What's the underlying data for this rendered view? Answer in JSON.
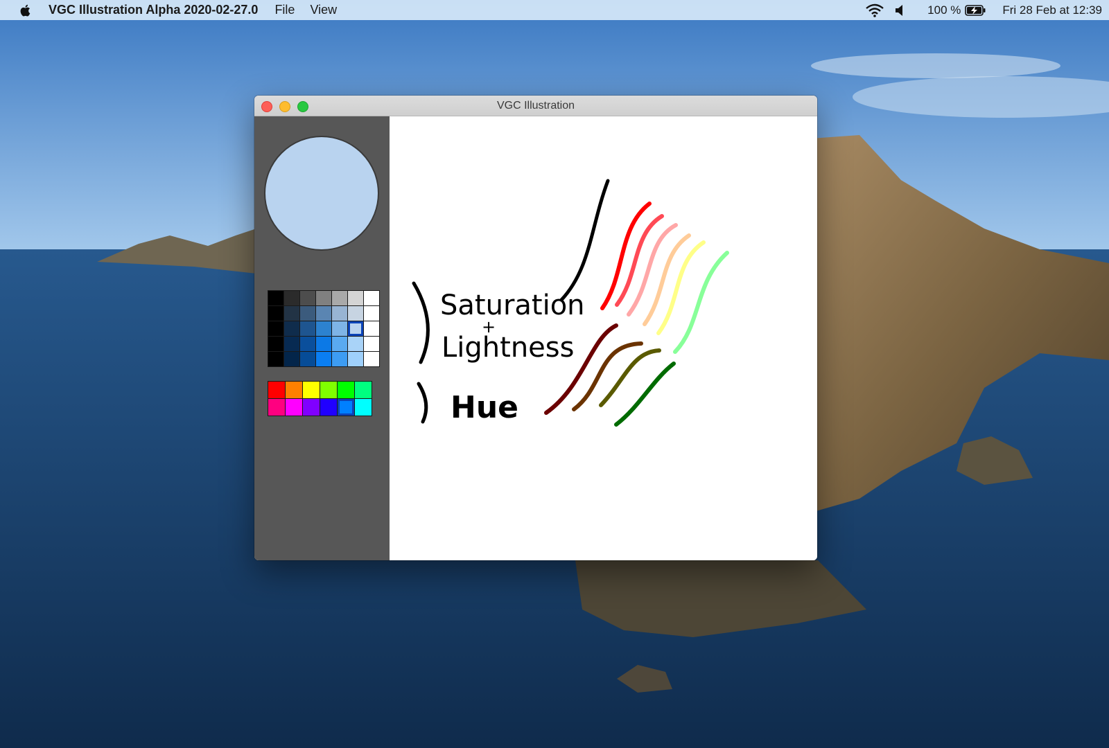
{
  "menubar": {
    "app_name": "VGC Illustration Alpha 2020-02-27.0",
    "menus": [
      "File",
      "View"
    ],
    "battery_percent": "100 %",
    "datetime": "Fri 28 Feb at  12:39"
  },
  "window": {
    "title": "VGC Illustration"
  },
  "palette": {
    "current_color": "#b9d3ef",
    "shade_grid": [
      [
        "#000000",
        "#2b2b2b",
        "#4d4d4d",
        "#808080",
        "#a9a9a9",
        "#d4d4d4",
        "#ffffff"
      ],
      [
        "#000000",
        "#223345",
        "#3b5b7d",
        "#5a85b2",
        "#98b4d3",
        "#c7d4e2",
        "#ffffff"
      ],
      [
        "#000000",
        "#0f2c4c",
        "#1e5590",
        "#2c82d0",
        "#7eb4e6",
        "#b9d3ef",
        "#ffffff"
      ],
      [
        "#000000",
        "#072a52",
        "#0a4f9c",
        "#0c79e6",
        "#5aaaf0",
        "#a9d3f8",
        "#ffffff"
      ],
      [
        "#000000",
        "#03254a",
        "#064c97",
        "#0a7ef2",
        "#3d9cf2",
        "#9fd0fb",
        "#ffffff"
      ]
    ],
    "shade_selected": {
      "row": 2,
      "col": 5
    },
    "hue_grid": [
      [
        "#ff0000",
        "#ff8000",
        "#ffff00",
        "#80ff00",
        "#00ff00",
        "#00ff80"
      ],
      [
        "#ff0080",
        "#ff00ff",
        "#8000ff",
        "#2000ff",
        "#0080ff",
        "#00ffff"
      ]
    ],
    "hue_selected": {
      "row": 1,
      "col": 4
    }
  },
  "canvas": {
    "annotation_saturation": "Saturation",
    "annotation_plus": "+",
    "annotation_lightness": "Lightness",
    "annotation_hue": "Hue",
    "stroke_colors": [
      "#000000",
      "#ff0000",
      "#ff4a55",
      "#ffa7a7",
      "#ffcc99",
      "#ffff88",
      "#88ff99",
      "#6b0000",
      "#6b3300",
      "#5a5a00",
      "#006b00"
    ]
  }
}
